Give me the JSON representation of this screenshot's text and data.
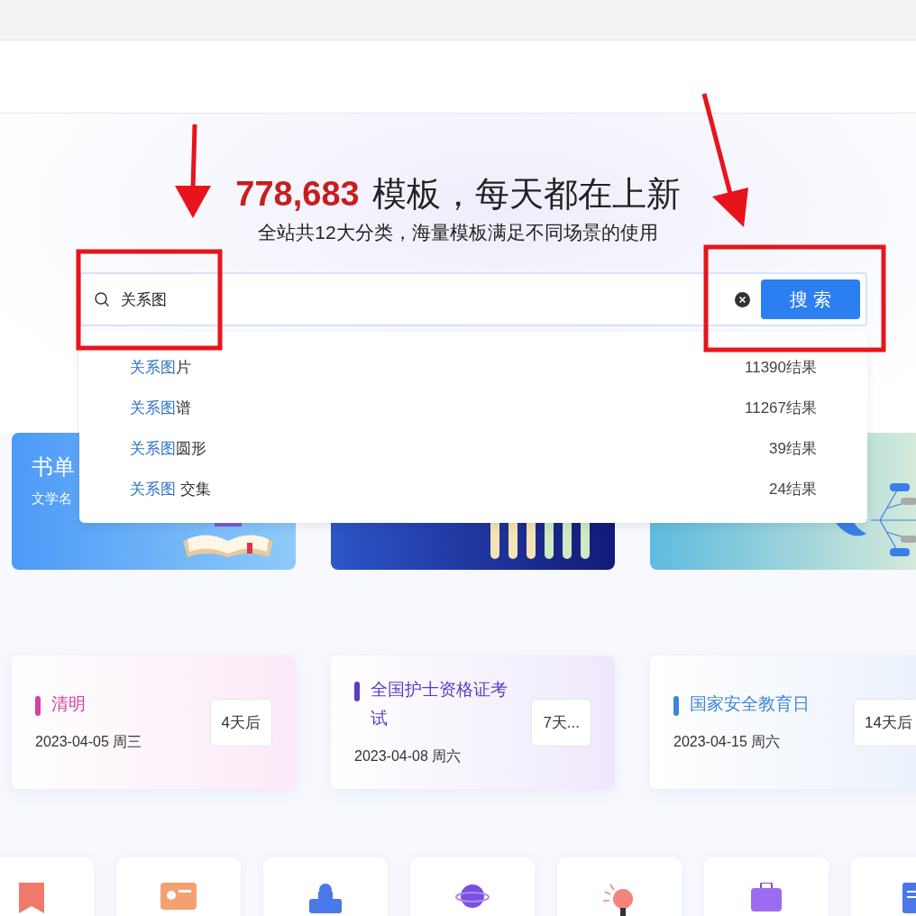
{
  "hero": {
    "count": "778,683",
    "title": "模板，每天都在上新",
    "subtitle": "全站共12大分类，海量模板满足不同场景的使用"
  },
  "search": {
    "value": "关系图",
    "button": "搜 索"
  },
  "suggestions": [
    {
      "match": "关系图",
      "rest": "片",
      "count": "11390结果"
    },
    {
      "match": "关系图",
      "rest": "谱",
      "count": "11267结果"
    },
    {
      "match": "关系图",
      "rest": "圆形",
      "count": "39结果"
    },
    {
      "match": "关系图",
      "rest": " 交集",
      "count": "24结果"
    }
  ],
  "banners": [
    {
      "kind": "book",
      "title": "书单",
      "subtitle": "文学名"
    },
    {
      "kind": "timeline"
    },
    {
      "kind": "mindmap"
    }
  ],
  "events": [
    {
      "name": "清明",
      "date": "2023-04-05 周三",
      "badge": "4天后",
      "color": "#d6409f"
    },
    {
      "name": "全国护士资格证考试",
      "date": "2023-04-08 周六",
      "badge": "7天...",
      "color": "#5b3cc4"
    },
    {
      "name": "国家安全教育日",
      "date": "2023-04-15 周六",
      "badge": "14天后",
      "color": "#3d86d8"
    }
  ],
  "categories": [
    {
      "kind": "bookmark"
    },
    {
      "kind": "teacher"
    },
    {
      "kind": "building"
    },
    {
      "kind": "planet"
    },
    {
      "kind": "bulb"
    },
    {
      "kind": "briefcase"
    },
    {
      "kind": "document"
    }
  ]
}
